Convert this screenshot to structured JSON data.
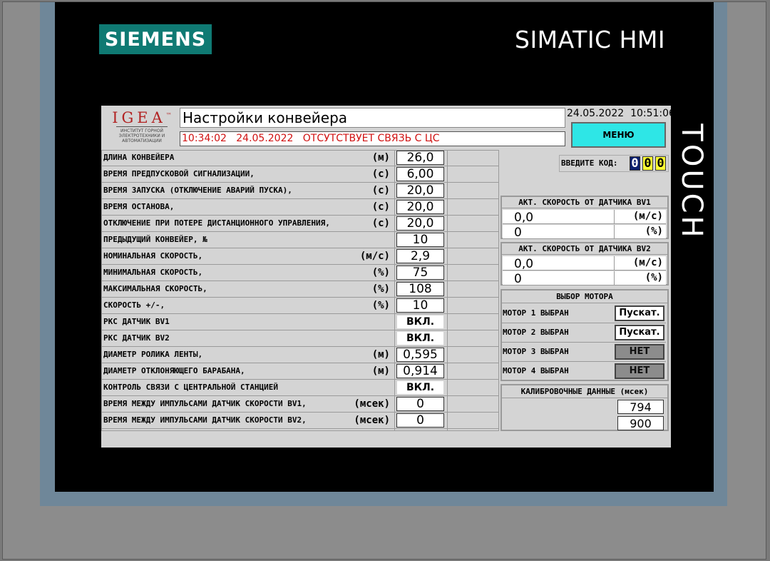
{
  "device": {
    "brand": "SIEMENS",
    "model": "SIMATIC HMI",
    "side_label": "TOUCH"
  },
  "header": {
    "logo_text": "IGEA",
    "logo_tm": "™",
    "logo_subtitle": "ИНСТИТУТ ГОРНОЙ ЭЛЕКТРОТЕХНИКИ И АВТОМАТИЗАЦИИ",
    "title": "Настройки конвейера",
    "alarm_time": "10:34:02",
    "alarm_date": "24.05.2022",
    "alarm_text": "ОТСУТСТВУЕТ СВЯЗЬ С ЦС",
    "date": "24.05.2022",
    "time": "10:51:06",
    "menu_label": "МЕНЮ"
  },
  "params": [
    {
      "label": "ДЛИНА КОНВЕЙЕРА",
      "unit": "(м)",
      "value": "26,0"
    },
    {
      "label": "ВРЕМЯ  ПРЕДПУСКОВОЙ СИГНАЛИЗАЦИИ,",
      "unit": "(с)",
      "value": "6,00"
    },
    {
      "label": "ВРЕМЯ ЗАПУСКА (ОТКЛЮЧЕНИЕ АВАРИЙ ПУСКА),",
      "unit": "(с)",
      "value": "20,0"
    },
    {
      "label": "ВРЕМЯ ОСТАНОВА,",
      "unit": "(с)",
      "value": "20,0"
    },
    {
      "label": "ОТКЛЮЧЕНИЕ ПРИ ПОТЕРЕ ДИСТАНЦИОННОГО УПРАВЛЕНИЯ,",
      "unit": "(с)",
      "value": "20,0"
    },
    {
      "label": "ПРЕДЫДУЩИЙ КОНВЕЙЕР, №",
      "unit": "",
      "value": "10"
    },
    {
      "label": "НОМИНАЛЬНАЯ СКОРОСТЬ,",
      "unit": "(м/с)",
      "value": "2,9"
    },
    {
      "label": "МИНИМАЛЬНАЯ СКОРОСТЬ,",
      "unit": "(%)",
      "value": "75"
    },
    {
      "label": "МАКСИМАЛЬНАЯ СКОРОСТЬ,",
      "unit": "(%)",
      "value": "108"
    },
    {
      "label": "СКОРОСТЬ  +/-,",
      "unit": "(%)",
      "value": "10"
    },
    {
      "label": "РКС  ДАТЧИК BV1",
      "unit": "",
      "value": "ВКЛ."
    },
    {
      "label": "РКС  ДАТЧИК BV2",
      "unit": "",
      "value": "ВКЛ."
    },
    {
      "label": "ДИАМЕТР РОЛИКА ЛЕНТЫ,",
      "unit": "(м)",
      "value": "0,595"
    },
    {
      "label": "ДИАМЕТР ОТКЛОНЯЮЩЕГО БАРАБАНА,",
      "unit": "(м)",
      "value": "0,914"
    },
    {
      "label": "КОНТРОЛЬ СВЯЗИ С ЦЕНТРАЛЬНОЙ СТАНЦИЕЙ",
      "unit": "",
      "value": "ВКЛ."
    },
    {
      "label": "ВРЕМЯ МЕЖДУ ИМПУЛЬСАМИ ДАТЧИК СКОРОСТИ BV1,",
      "unit": "(мсек)",
      "value": "0"
    },
    {
      "label": "ВРЕМЯ МЕЖДУ ИМПУЛЬСАМИ ДАТЧИК СКОРОСТИ BV2,",
      "unit": "(мсек)",
      "value": "0"
    }
  ],
  "code": {
    "label": "ВВЕДИТЕ КОД:",
    "digits": [
      "0",
      "0",
      "0"
    ]
  },
  "speed_bv1": {
    "title": "АКТ. СКОРОСТЬ ОТ ДАТЧИКА BV1",
    "value_ms": "0,0",
    "unit_ms": "(м/с)",
    "value_pct": "0",
    "unit_pct": "(%)"
  },
  "speed_bv2": {
    "title": "АКТ. СКОРОСТЬ ОТ ДАТЧИКА BV2",
    "value_ms": "0,0",
    "unit_ms": "(м/с)",
    "value_pct": "0",
    "unit_pct": "(%)"
  },
  "motor_select": {
    "title": "ВЫБОР МОТОРА",
    "motors": [
      {
        "label": "МОТОР 1 ВЫБРАН",
        "state": "Пускат."
      },
      {
        "label": "МОТОР 2 ВЫБРАН",
        "state": "Пускат."
      },
      {
        "label": "МОТОР 3 ВЫБРАН",
        "state": "НЕТ"
      },
      {
        "label": "МОТОР 4 ВЫБРАН",
        "state": "НЕТ"
      }
    ]
  },
  "calibration": {
    "title": "КАЛИБРОВОЧНЫЕ ДАННЫЕ (мсек)",
    "values": [
      "794",
      "900"
    ]
  },
  "colors": {
    "brand_teal": "#0f7a73",
    "menu_cyan": "#2ee6e6",
    "alarm_red": "#d01010",
    "code_digit_1_bg": "#0a1f6e",
    "code_digit_bg": "#ffff33"
  }
}
